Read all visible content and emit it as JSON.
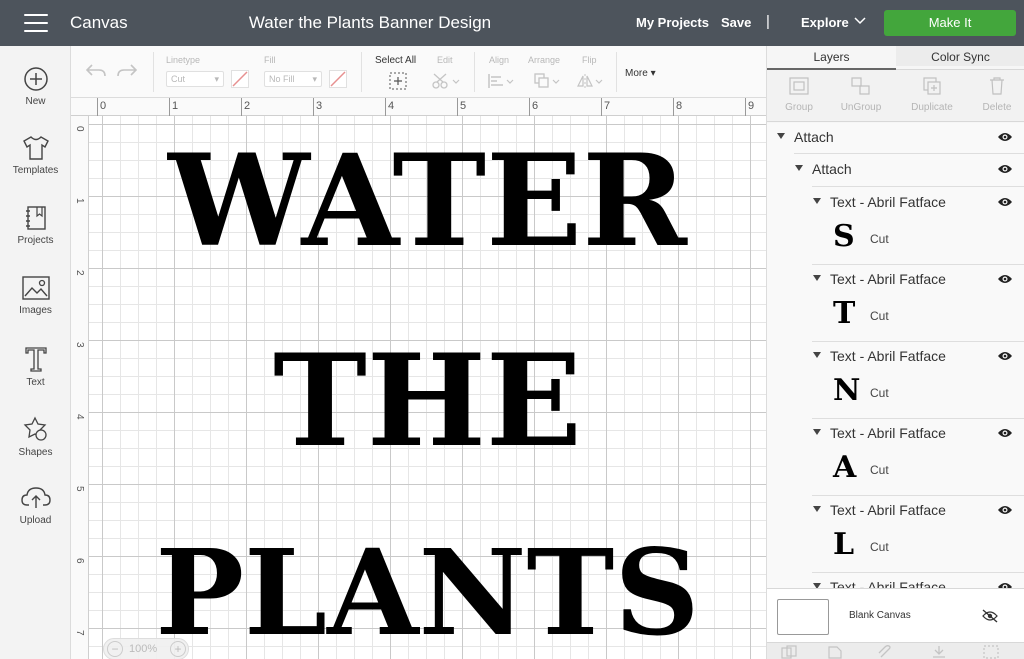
{
  "topbar": {
    "app_title": "Canvas",
    "project_title": "Water the Plants Banner Design",
    "my_projects": "My Projects",
    "save": "Save",
    "separator": "|",
    "explore": "Explore",
    "make_it": "Make It",
    "make_it_color": "#43a63c",
    "bar_color": "#4d545c"
  },
  "sidebar": {
    "items": [
      {
        "label": "New",
        "icon": "plus-circle-icon"
      },
      {
        "label": "Templates",
        "icon": "tshirt-icon"
      },
      {
        "label": "Projects",
        "icon": "notebook-icon"
      },
      {
        "label": "Images",
        "icon": "image-icon"
      },
      {
        "label": "Text",
        "icon": "text-t-icon"
      },
      {
        "label": "Shapes",
        "icon": "shapes-icon"
      },
      {
        "label": "Upload",
        "icon": "cloud-upload-icon"
      }
    ]
  },
  "toolbar": {
    "linetype_label": "Linetype",
    "linetype_value": "Cut",
    "fill_label": "Fill",
    "fill_value": "No Fill",
    "select_all": "Select All",
    "edit": "Edit",
    "align": "Align",
    "arrange": "Arrange",
    "flip": "Flip",
    "more": "More"
  },
  "rulers": {
    "top": [
      "0",
      "1",
      "2",
      "3",
      "4",
      "5",
      "6",
      "7",
      "8",
      "9"
    ],
    "left": [
      "0",
      "1",
      "2",
      "3",
      "4",
      "5",
      "6",
      "7"
    ]
  },
  "canvas": {
    "lines": [
      "WATER",
      "THE",
      "PLANTS"
    ],
    "zoom": "100%",
    "zoom_minus": "−",
    "zoom_plus": "+"
  },
  "panel": {
    "tabs": [
      "Layers",
      "Color Sync"
    ],
    "tools": [
      "Group",
      "UnGroup",
      "Duplicate",
      "Delete"
    ],
    "attach_outer": "Attach",
    "attach_inner": "Attach",
    "text_layers": [
      {
        "label": "Text - Abril Fatface",
        "glyph": "S",
        "op": "Cut"
      },
      {
        "label": "Text - Abril Fatface",
        "glyph": "T",
        "op": "Cut"
      },
      {
        "label": "Text - Abril Fatface",
        "glyph": "N",
        "op": "Cut"
      },
      {
        "label": "Text - Abril Fatface",
        "glyph": "A",
        "op": "Cut"
      },
      {
        "label": "Text - Abril Fatface",
        "glyph": "L",
        "op": "Cut"
      },
      {
        "label": "Text - Abril Fatface"
      }
    ],
    "blank_canvas": "Blank Canvas"
  }
}
